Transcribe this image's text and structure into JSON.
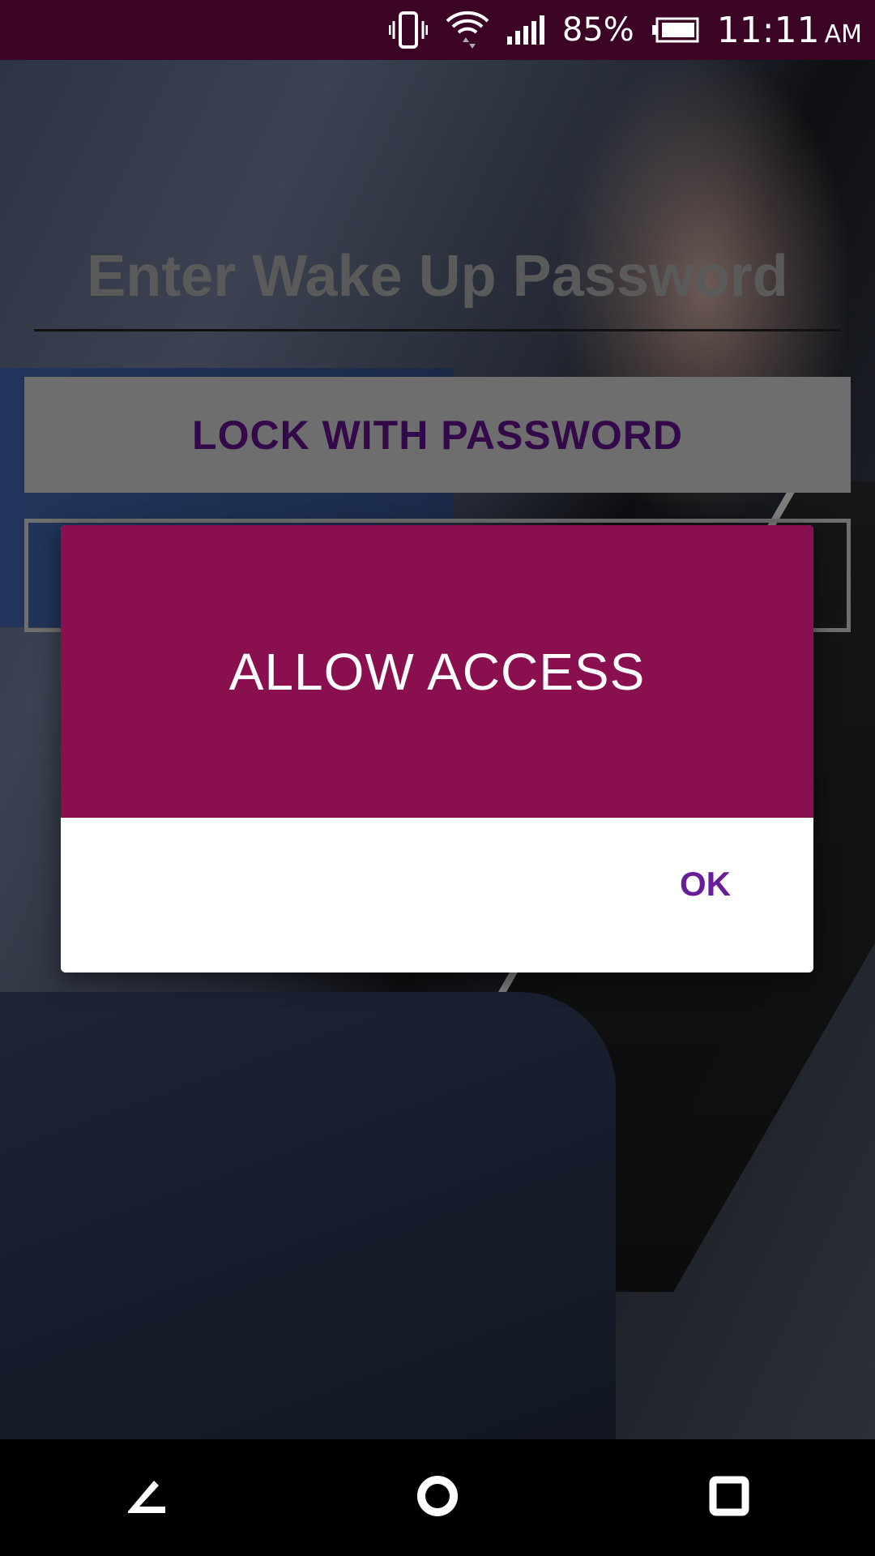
{
  "status_bar": {
    "battery_percent": "85%",
    "time": "11:11",
    "ampm": "AM",
    "icons": [
      "vibrate-icon",
      "wifi-icon",
      "signal-icon",
      "battery-icon"
    ]
  },
  "app": {
    "password_hint": "Enter Wake Up Password",
    "lock_button_label": "LOCK WITH PASSWORD"
  },
  "dialog": {
    "title": "ALLOW ACCESS",
    "ok_label": "OK",
    "header_color": "#8a0f4f",
    "ok_color": "#6a1d9a"
  },
  "nav_bar": {
    "icons": [
      "back-icon",
      "home-icon",
      "recents-icon"
    ]
  }
}
